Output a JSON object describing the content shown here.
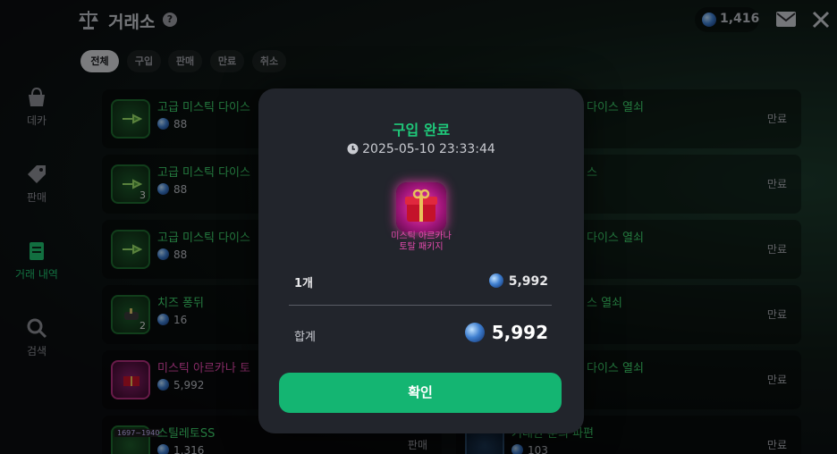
{
  "header": {
    "title": "거래소",
    "help": "?",
    "balance": "1,416"
  },
  "filters": [
    "전체",
    "구입",
    "판매",
    "만료",
    "취소"
  ],
  "sidebar": [
    {
      "label": "데카",
      "icon": "shop-icon"
    },
    {
      "label": "판매",
      "icon": "tag-icon"
    },
    {
      "label": "거래 내역",
      "icon": "history-icon"
    },
    {
      "label": "검색",
      "icon": "search-icon"
    }
  ],
  "left_rows": [
    {
      "name": "고급 미스틱 다이스",
      "price": "88",
      "qty": "",
      "status": ""
    },
    {
      "name": "고급 미스틱 다이스",
      "price": "88",
      "qty": "3",
      "status": ""
    },
    {
      "name": "고급 미스틱 다이스",
      "price": "88",
      "qty": "",
      "status": ""
    },
    {
      "name": "치즈 퐁뒤",
      "price": "16",
      "qty": "2",
      "status": ""
    },
    {
      "name": "미스틱 아르카나 토",
      "price": "5,992",
      "qty": "",
      "status": ""
    },
    {
      "name": "스틸레토SS",
      "price": "1,316",
      "qty": "",
      "status": "판매",
      "tag": "1697~1940"
    }
  ],
  "right_rows": [
    {
      "name": "다이스 열쇠",
      "status": "만료"
    },
    {
      "name": "스",
      "status": "만료"
    },
    {
      "name": "다이스 열쇠",
      "status": "만료"
    },
    {
      "name": "스 열쇠",
      "status": "만료"
    },
    {
      "name": "다이스 열쇠",
      "status": "만료"
    },
    {
      "name": "거대한 룬의 파편",
      "price": "103",
      "status": "만료"
    }
  ],
  "modal": {
    "title": "구입 완료",
    "time": "2025-05-10 23:33:44",
    "item_name_line1": "미스틱 아르카나",
    "item_name_line2": "토탈 패키지",
    "qty_label": "1개",
    "qty_value": "5,992",
    "total_label": "합계",
    "total_value": "5,992",
    "confirm_label": "확인"
  }
}
